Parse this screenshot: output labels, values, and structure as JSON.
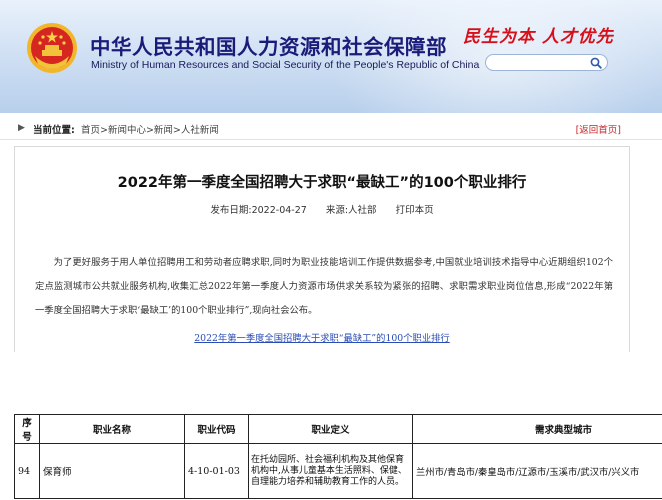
{
  "header": {
    "ministry_cn": "中华人民共和国人力资源和社会保障部",
    "ministry_en": "Ministry of Human Resources and Social Security of the People's Republic of China",
    "slogan": "民生为本 人才优先",
    "search": {
      "value": "",
      "placeholder": ""
    },
    "colors": {
      "title": "#1b1b7a",
      "slogan": "#d6101a",
      "banner": "#c3d7ef"
    }
  },
  "breadcrumb": {
    "label": "当前位置:",
    "path": "首页>新闻中心>新闻>人社新闻",
    "back": "[返回首页]"
  },
  "article": {
    "title": "2022年第一季度全国招聘大于求职“最缺工”的100个职业排行",
    "date": "发布日期:2022-04-27",
    "source": "来源:人社部",
    "print": "打印本页",
    "body": "为了更好服务于用人单位招聘用工和劳动者应聘求职,同时为职业技能培训工作提供数据参考,中国就业培训技术指导中心近期组织102个定点监测城市公共就业服务机构,收集汇总2022年第一季度人力资源市场供求关系较为紧张的招聘、求职需求职业岗位信息,形成“2022年第一季度全国招聘大于求职‘最缺工’的100个职业排行”,现向社会公布。",
    "link": "2022年第一季度全国招聘大于求职“最缺工”的100个职业排行"
  },
  "table": {
    "headers": [
      "序号",
      "职业名称",
      "职业代码",
      "职业定义",
      "需求典型城市"
    ],
    "rows": [
      {
        "rank": "94",
        "name": "保育师",
        "code": "4-10-01-03",
        "definition": "在托幼园所、社会福利机构及其他保育机构中,从事儿童基本生活照料、保健、自理能力培养和辅助教育工作的人员。",
        "cities": "兰州市/青岛市/秦皇岛市/辽源市/玉溪市/武汉市/兴义市"
      }
    ]
  }
}
